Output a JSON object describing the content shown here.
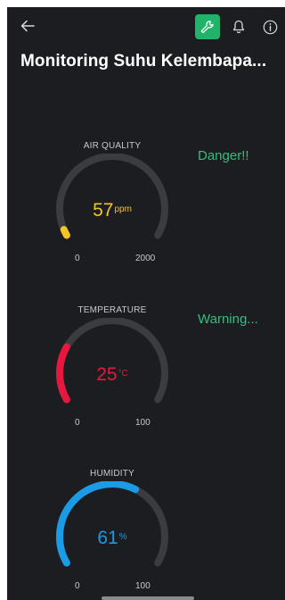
{
  "header": {
    "title": "Monitoring Suhu Kelembapa...",
    "icons": {
      "back": "arrow-left-icon",
      "settings": "wrench-icon",
      "notifications": "bell-icon",
      "info": "info-icon"
    },
    "settings_button_color": "#21b36b"
  },
  "gauges": [
    {
      "title": "AIR QUALITY",
      "value": "57",
      "unit": "ppm",
      "min": "0",
      "max": "2000",
      "color": "#f6c324",
      "fraction": 0.0285,
      "status": "Danger!!"
    },
    {
      "title": "TEMPERATURE",
      "value": "25",
      "unit": "°C",
      "min": "0",
      "max": "100",
      "color": "#e8173f",
      "fraction": 0.25,
      "status": "Warning..."
    },
    {
      "title": "HUMIDITY",
      "value": "61",
      "unit": "%",
      "min": "0",
      "max": "100",
      "color": "#1b9be5",
      "fraction": 0.61,
      "status": ""
    }
  ],
  "colors": {
    "background": "#1c1d20",
    "gauge_track": "#3b3c40",
    "status_text": "#2fc07f"
  }
}
